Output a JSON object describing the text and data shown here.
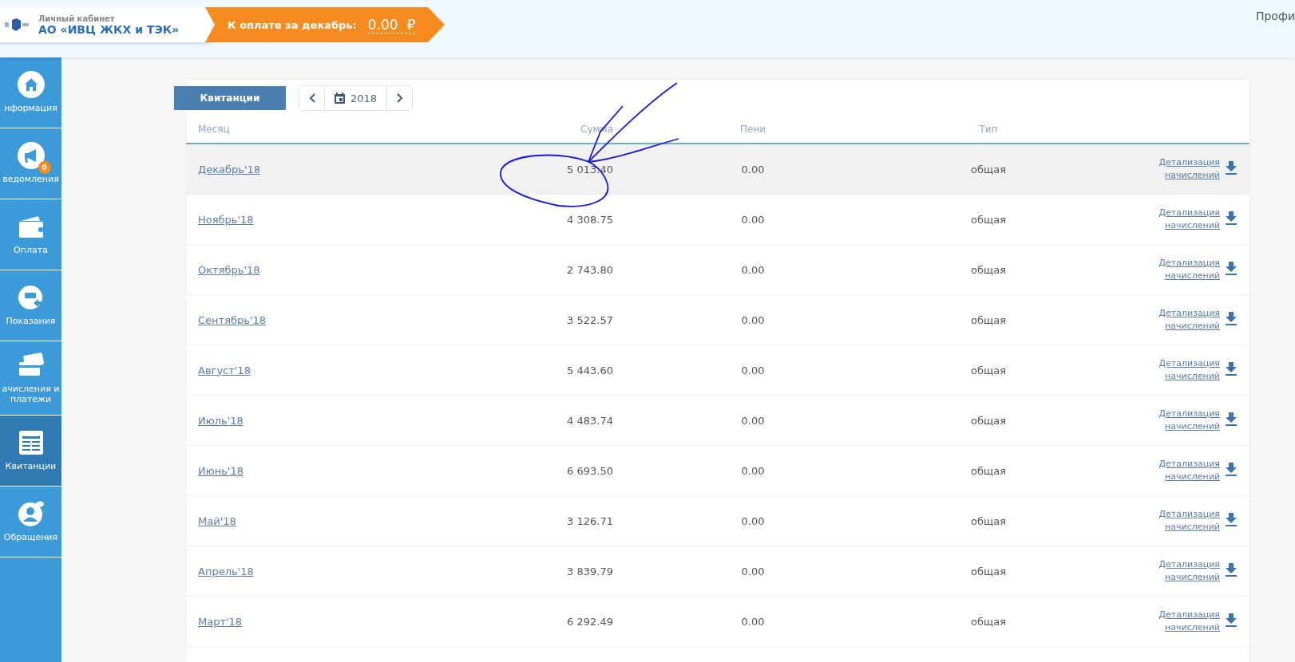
{
  "header": {
    "cabinet_label": "Личный кабинет",
    "company": "АО «ИВЦ ЖКХ и ТЭК»",
    "payment_label": "К оплате за декабрь:",
    "payment_amount": "0.00",
    "currency": "₽",
    "profile": "Профи"
  },
  "sidebar": {
    "items": [
      {
        "label": "нформация",
        "selected": false
      },
      {
        "label": "ведомления",
        "selected": false,
        "badge": "0"
      },
      {
        "label": "Оплата",
        "selected": false
      },
      {
        "label": "Показания",
        "selected": false
      },
      {
        "label": "ачисления и платежи",
        "selected": false
      },
      {
        "label": "Квитанции",
        "selected": true
      },
      {
        "label": "Обращения",
        "selected": false
      }
    ]
  },
  "toolbar": {
    "receipts_button": "Квитанции",
    "year": "2018"
  },
  "table": {
    "columns": [
      "Месяц",
      "Сумма",
      "Пени",
      "Тип"
    ],
    "rows": [
      {
        "month": "Декабрь'18",
        "sum": "5 013.40",
        "penalty": "0.00",
        "type": "общая",
        "detail": "Детализация начислений",
        "selected": true
      },
      {
        "month": "Ноябрь'18",
        "sum": "4 308.75",
        "penalty": "0.00",
        "type": "общая",
        "detail": "Детализация начислений",
        "selected": false
      },
      {
        "month": "Октябрь'18",
        "sum": "2 743.80",
        "penalty": "0.00",
        "type": "общая",
        "detail": "Детализация начислений",
        "selected": false
      },
      {
        "month": "Сентябрь'18",
        "sum": "3 522.57",
        "penalty": "0.00",
        "type": "общая",
        "detail": "Детализация начислений",
        "selected": false
      },
      {
        "month": "Август'18",
        "sum": "5 443.60",
        "penalty": "0.00",
        "type": "общая",
        "detail": "Детализация начислений",
        "selected": false
      },
      {
        "month": "Июль'18",
        "sum": "4 483.74",
        "penalty": "0.00",
        "type": "общая",
        "detail": "Детализация начислений",
        "selected": false
      },
      {
        "month": "Июнь'18",
        "sum": "6 693.50",
        "penalty": "0.00",
        "type": "общая",
        "detail": "Детализация начислений",
        "selected": false
      },
      {
        "month": "Май'18",
        "sum": "3 126.71",
        "penalty": "0.00",
        "type": "общая",
        "detail": "Детализация начислений",
        "selected": false
      },
      {
        "month": "Апрель'18",
        "sum": "3 839.79",
        "penalty": "0.00",
        "type": "общая",
        "detail": "Детализация начислений",
        "selected": false
      },
      {
        "month": "Март'18",
        "sum": "6 292.49",
        "penalty": "0.00",
        "type": "общая",
        "detail": "Детализация начислений",
        "selected": false
      }
    ]
  }
}
